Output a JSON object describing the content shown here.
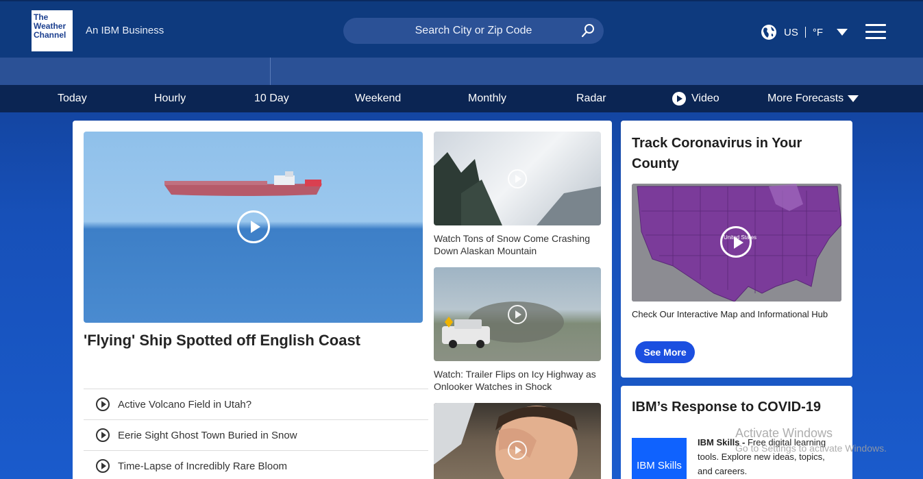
{
  "header": {
    "logo_lines": [
      "The",
      "Weather",
      "Channel"
    ],
    "tagline": "An IBM Business",
    "search_placeholder": "Search City or Zip Code",
    "region": "US",
    "unit": "°F"
  },
  "nav": {
    "items": [
      "Today",
      "Hourly",
      "10 Day",
      "Weekend",
      "Monthly",
      "Radar",
      "Video",
      "More Forecasts"
    ]
  },
  "main": {
    "hero_title": "'Flying' Ship Spotted off English Coast",
    "list": [
      "Active Volcano Field in Utah?",
      "Eerie Sight Ghost Town Buried in Snow",
      "Time-Lapse of Incredibly Rare Bloom"
    ],
    "thumbs": [
      "Watch Tons of Snow Come Crashing Down Alaskan Mountain",
      "Watch: Trailer Flips on Icy Highway as Onlooker Watches in Shock"
    ]
  },
  "covid": {
    "title": "Track Coronavirus in Your County",
    "map_label": "United States",
    "caption": "Check Our Interactive Map and Informational Hub",
    "button": "See More"
  },
  "ibm": {
    "title": "IBM’s Response to COVID-19",
    "logo_text": "IBM Skills",
    "bold": "IBM Skills -",
    "text": " Free digital learning tools. Explore new ideas, topics, and careers."
  },
  "watermark": {
    "line1": "Activate Windows",
    "line2": "Go to Settings to activate Windows."
  }
}
